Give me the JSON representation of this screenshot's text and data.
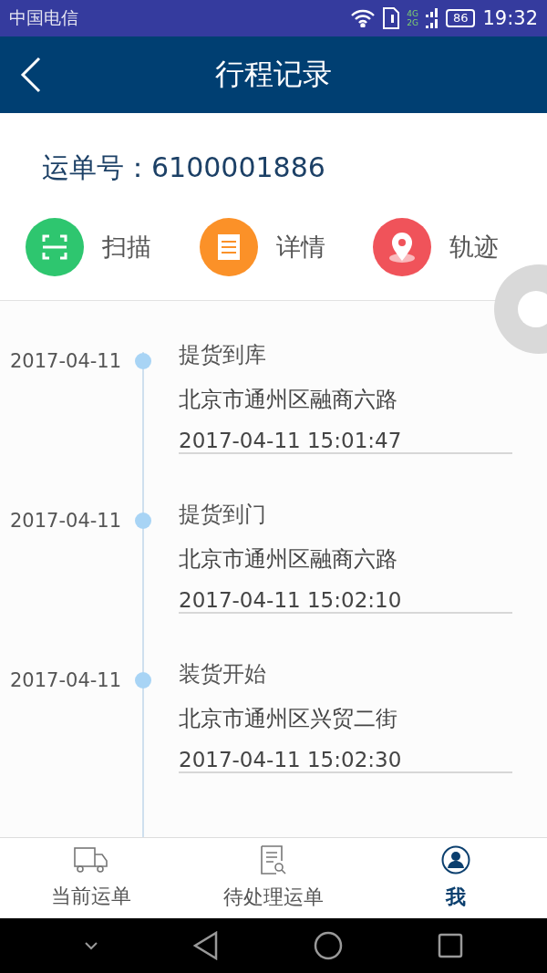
{
  "status_bar": {
    "carrier": "中国电信",
    "network_top": "4G",
    "network_bottom": "2G",
    "battery": "86",
    "time": "19:32"
  },
  "header": {
    "title": "行程记录"
  },
  "waybill": {
    "label": "运单号：",
    "number": "6100001886"
  },
  "actions": [
    {
      "kind": "scan",
      "label": "扫描",
      "color": "#2ec66f"
    },
    {
      "kind": "details",
      "label": "详情",
      "color": "#fb9128"
    },
    {
      "kind": "track",
      "label": "轨迹",
      "color": "#f0535a"
    }
  ],
  "timeline": [
    {
      "date": "2017-04-11",
      "title": "提货到库",
      "address": "北京市通州区融商六路",
      "time": "2017-04-11 15:01:47"
    },
    {
      "date": "2017-04-11",
      "title": "提货到门",
      "address": "北京市通州区融商六路",
      "time": "2017-04-11 15:02:10"
    },
    {
      "date": "2017-04-11",
      "title": "装货开始",
      "address": "北京市通州区兴贸二街",
      "time": "2017-04-11 15:02:30"
    }
  ],
  "tab_bar": [
    {
      "kind": "truck",
      "label": "当前运单",
      "selected": false
    },
    {
      "kind": "document",
      "label": "待处理运单",
      "selected": false
    },
    {
      "kind": "person",
      "label": "我",
      "selected": true
    }
  ]
}
